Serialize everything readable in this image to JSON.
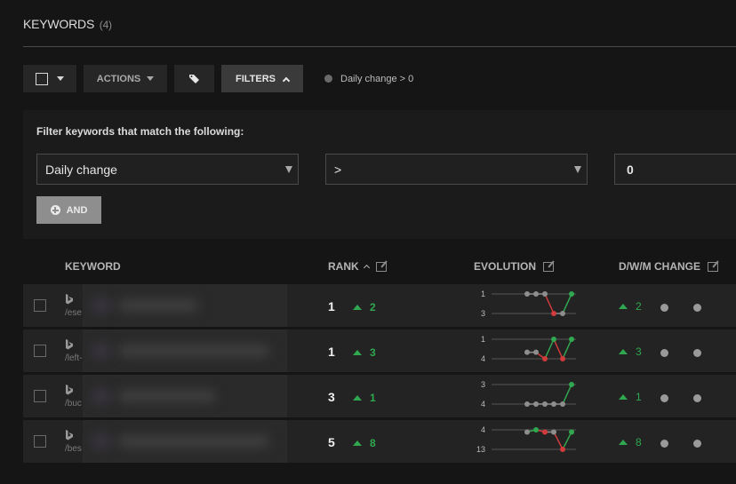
{
  "header": {
    "title": "KEYWORDS",
    "count": "(4)"
  },
  "toolbar": {
    "select_all_icon": "checkbox-dropdown",
    "actions_label": "ACTIONS",
    "tags_icon": "tags-icon",
    "filters_label": "FILTERS",
    "active_filter": "Daily change > 0"
  },
  "filter_panel": {
    "label": "Filter keywords that match the following:",
    "field_value": "Daily change",
    "operator_value": ">",
    "value": "0",
    "and_label": "AND"
  },
  "table": {
    "columns": {
      "keyword": "KEYWORD",
      "rank": "RANK",
      "evolution": "EVOLUTION",
      "dwm": "D/W/M CHANGE"
    },
    "rows": [
      {
        "url": "/ese",
        "rank": "1",
        "rank_change": "2",
        "evo_top": "1",
        "evo_bottom": "3",
        "evo_points": [
          1,
          1,
          1,
          3,
          3,
          1
        ],
        "evo_range": [
          1,
          3
        ],
        "daily": "2"
      },
      {
        "url": "/left-",
        "rank": "1",
        "rank_change": "3",
        "evo_top": "1",
        "evo_bottom": "4",
        "evo_points": [
          3,
          3,
          4,
          1,
          4,
          1
        ],
        "evo_range": [
          1,
          4
        ],
        "daily": "3"
      },
      {
        "url": "/buc",
        "rank": "3",
        "rank_change": "1",
        "evo_top": "3",
        "evo_bottom": "4",
        "evo_points": [
          4,
          4,
          4,
          4,
          4,
          3
        ],
        "evo_range": [
          3,
          4
        ],
        "daily": "1"
      },
      {
        "url": "/bes",
        "rank": "5",
        "rank_change": "8",
        "evo_top": "4",
        "evo_bottom": "13",
        "evo_points": [
          5,
          4,
          5,
          5,
          13,
          5
        ],
        "evo_range": [
          4,
          13
        ],
        "daily": "8"
      }
    ]
  },
  "colors": {
    "up": "#2fa84f",
    "down": "#d23b3b",
    "neutral": "#8e8e8e"
  }
}
